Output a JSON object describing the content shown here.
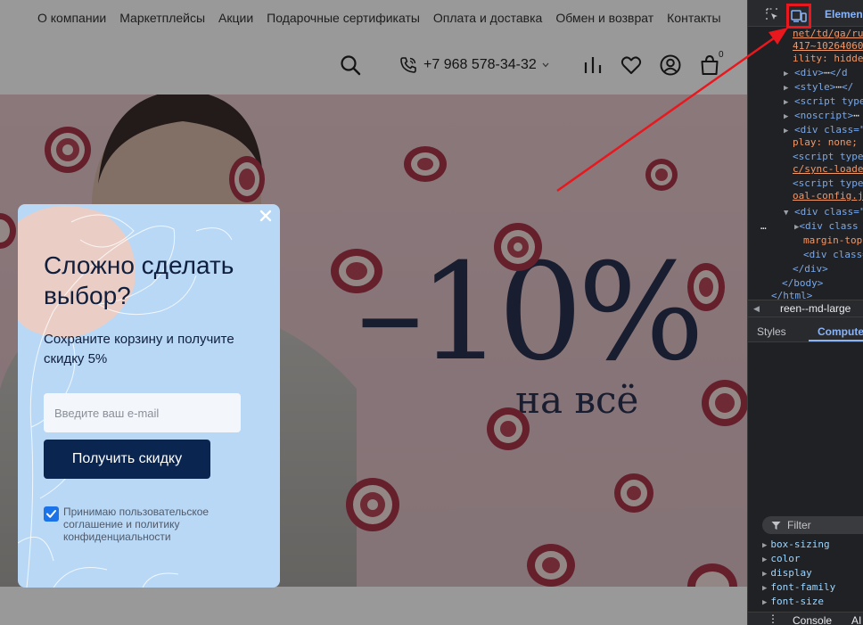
{
  "site": {
    "nav": [
      "О компании",
      "Маркетплейсы",
      "Акции",
      "Подарочные сертификаты",
      "Оплата и доставка",
      "Обмен и возврат",
      "Контакты"
    ],
    "phone": "+7 968 578-34-32",
    "cart_count": "0",
    "icons": [
      "search-icon",
      "phone-icon",
      "compare-icon",
      "heart-icon",
      "user-icon",
      "cart-icon"
    ]
  },
  "banner": {
    "discount": "–10%",
    "subtitle": "на всё"
  },
  "modal": {
    "title": "Сложно сделать выбор?",
    "text": "Сохраните корзину и получите скидку 5%",
    "email_placeholder": "Введите ваш e-mail",
    "submit_label": "Получить скидку",
    "consent_checked": true,
    "consent_text": "Принимаю пользовательское соглашение и политику конфиденциальности",
    "colors": {
      "background": "#b8d8f6",
      "button": "#0a2550"
    }
  },
  "annotation": {
    "color": "#e8181e"
  },
  "devtools": {
    "tab_elements": "Elemen",
    "tree": {
      "l0": "net/td/ga/ru",
      "l1": "417~10264060",
      "l2": "ility: hidde",
      "l3_tag": "<div>",
      "l3_rest": "</d",
      "l4_tag": "<style>",
      "l4_rest": "</",
      "l5": "<script type",
      "l6": "<noscript>",
      "l7": "<div class=\"",
      "l8": "play: none;",
      "l9": "<script type",
      "l10": "c/sync-loade",
      "l11": "<script type",
      "l12": "oal-config.j",
      "l13": "<div class=\"",
      "l14": "<div class",
      "l15": "margin-top",
      "l16": "<div class=",
      "l17": "</div>",
      "l18": "</body>",
      "l19": "</html>"
    },
    "breadcrumb": "reen--md-large",
    "subtabs": {
      "styles": "Styles",
      "computed": "Compute"
    },
    "filter_label": "Filter",
    "properties": [
      "box-sizing",
      "color",
      "display",
      "font-family",
      "font-size"
    ],
    "bottom": {
      "dots": "⋮",
      "console": "Console",
      "ai": "AI"
    }
  }
}
